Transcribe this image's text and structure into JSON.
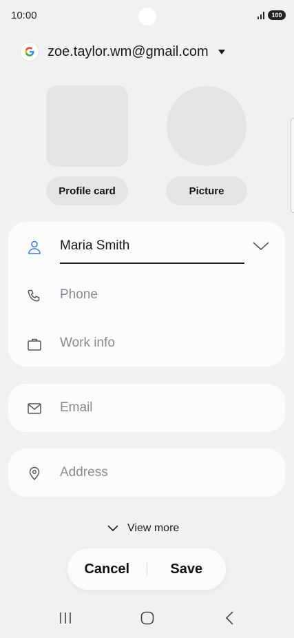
{
  "status_bar": {
    "time": "10:00",
    "battery": "100"
  },
  "account": {
    "email": "zoe.taylor.wm@gmail.com",
    "icon": "google-g-icon"
  },
  "photo": {
    "profile_card_label": "Profile card",
    "picture_label": "Picture"
  },
  "fields": {
    "name": {
      "value": "Maria Smith",
      "icon": "person-icon"
    },
    "phone": {
      "placeholder": "Phone",
      "icon": "phone-icon"
    },
    "work": {
      "placeholder": "Work info",
      "icon": "briefcase-icon"
    },
    "email": {
      "placeholder": "Email",
      "icon": "mail-icon"
    },
    "address": {
      "placeholder": "Address",
      "icon": "location-pin-icon"
    }
  },
  "view_more": {
    "label": "View more"
  },
  "actions": {
    "cancel_label": "Cancel",
    "save_label": "Save"
  },
  "nav": {
    "items": [
      "recent-apps-icon",
      "home-icon",
      "back-icon"
    ]
  },
  "colors": {
    "accent": "#3e7bd6",
    "background": "#f1f1f3",
    "card": "#fbfbfd"
  }
}
